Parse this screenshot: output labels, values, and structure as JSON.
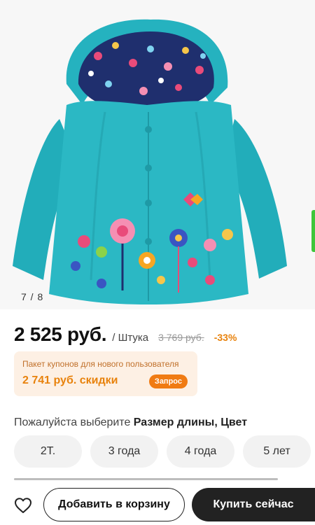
{
  "gallery": {
    "counter": "7 / 8",
    "product_image": "teal-hooded-raincoat-with-floral-print"
  },
  "price": {
    "current": "2 525 руб.",
    "unit": "/ Штука",
    "old": "3 769 руб.",
    "discount": "-33%"
  },
  "coupon": {
    "title": "Пакет купонов для нового пользователя",
    "amount": "2 741 руб. скидки",
    "button": "Запрос"
  },
  "select": {
    "prompt": "Пожалуйста выберите",
    "options_label": "Размер длины, Цвет"
  },
  "sizes": [
    "2T.",
    "3 года",
    "4 года",
    "5 лет"
  ],
  "actions": {
    "favorite_icon": "heart-icon",
    "add_to_cart": "Добавить в корзину",
    "buy_now": "Купить сейчас"
  },
  "colors": {
    "accent": "#e8820c",
    "coupon_bg": "#fdf0e4",
    "jacket": "#2bb8c4",
    "dark_button": "#222222"
  }
}
